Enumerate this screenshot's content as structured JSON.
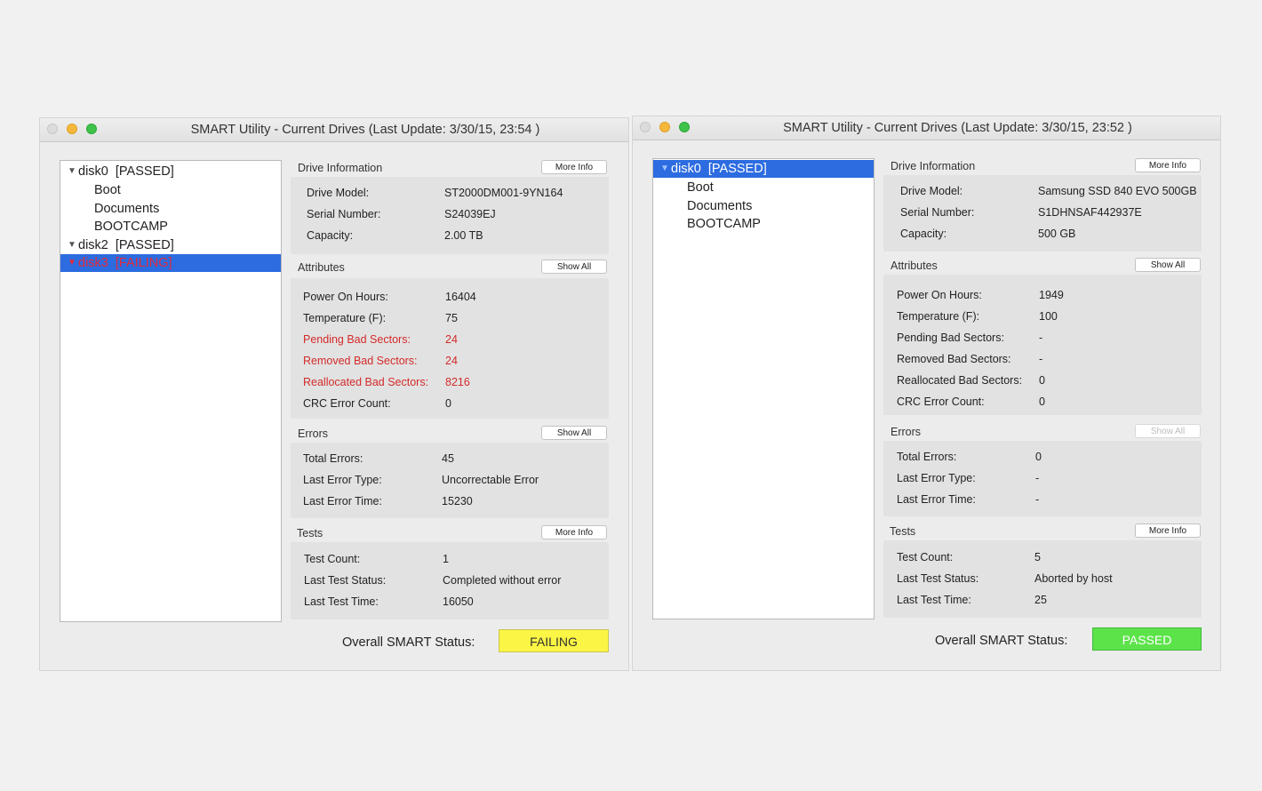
{
  "left": {
    "title": "SMART Utility - Current Drives (Last Update: 3/30/15, 23:54 )",
    "tree": [
      {
        "label": "disk0  [PASSED]"
      },
      {
        "label": "Boot"
      },
      {
        "label": "Documents"
      },
      {
        "label": "BOOTCAMP"
      },
      {
        "label": "disk2  [PASSED]"
      },
      {
        "label": "disk3  [FAILING]"
      }
    ],
    "drive_info": {
      "heading": "Drive Information",
      "button": "More Info",
      "model_label": "Drive Model:",
      "model": "ST2000DM001-9YN164",
      "serial_label": "Serial Number:",
      "serial": "S24039EJ",
      "capacity_label": "Capacity:",
      "capacity": "2.00 TB"
    },
    "attributes": {
      "heading": "Attributes",
      "button": "Show All",
      "rows": [
        {
          "label": "Power On Hours:",
          "value": "16404"
        },
        {
          "label": "Temperature (F):",
          "value": "75"
        },
        {
          "label": "Pending Bad Sectors:",
          "value": "24"
        },
        {
          "label": "Removed Bad Sectors:",
          "value": "24"
        },
        {
          "label": "Reallocated Bad Sectors:",
          "value": "8216"
        },
        {
          "label": "CRC Error Count:",
          "value": "0"
        }
      ]
    },
    "errors": {
      "heading": "Errors",
      "button": "Show All",
      "rows": [
        {
          "label": "Total Errors:",
          "value": "45"
        },
        {
          "label": "Last Error Type:",
          "value": "Uncorrectable Error"
        },
        {
          "label": "Last Error Time:",
          "value": "15230"
        }
      ]
    },
    "tests": {
      "heading": "Tests",
      "button": "More Info",
      "rows": [
        {
          "label": "Test Count:",
          "value": "1"
        },
        {
          "label": "Last Test Status:",
          "value": "Completed without error"
        },
        {
          "label": "Last Test Time:",
          "value": "16050"
        }
      ]
    },
    "overall": {
      "label": "Overall SMART Status:",
      "value": "FAILING"
    }
  },
  "right": {
    "title": "SMART Utility - Current Drives (Last Update: 3/30/15, 23:52 )",
    "tree": [
      {
        "label": "disk0  [PASSED]"
      },
      {
        "label": "Boot"
      },
      {
        "label": "Documents"
      },
      {
        "label": "BOOTCAMP"
      }
    ],
    "drive_info": {
      "heading": "Drive Information",
      "button": "More Info",
      "model_label": "Drive Model:",
      "model": "Samsung SSD 840 EVO 500GB",
      "serial_label": "Serial Number:",
      "serial": "S1DHNSAF442937E",
      "capacity_label": "Capacity:",
      "capacity": "500 GB"
    },
    "attributes": {
      "heading": "Attributes",
      "button": "Show All",
      "rows": [
        {
          "label": "Power On Hours:",
          "value": "1949"
        },
        {
          "label": "Temperature (F):",
          "value": "100"
        },
        {
          "label": "Pending Bad Sectors:",
          "value": "-"
        },
        {
          "label": "Removed Bad Sectors:",
          "value": "-"
        },
        {
          "label": "Reallocated Bad Sectors:",
          "value": "0"
        },
        {
          "label": "CRC Error Count:",
          "value": "0"
        }
      ]
    },
    "errors": {
      "heading": "Errors",
      "button": "Show All",
      "rows": [
        {
          "label": "Total Errors:",
          "value": "0"
        },
        {
          "label": "Last Error Type:",
          "value": "-"
        },
        {
          "label": "Last Error Time:",
          "value": "-"
        }
      ]
    },
    "tests": {
      "heading": "Tests",
      "button": "More Info",
      "rows": [
        {
          "label": "Test Count:",
          "value": "5"
        },
        {
          "label": "Last Test Status:",
          "value": "Aborted by host"
        },
        {
          "label": "Last Test Time:",
          "value": "25"
        }
      ]
    },
    "overall": {
      "label": "Overall SMART Status:",
      "value": "PASSED"
    }
  },
  "colors": {
    "selection": "#2c6ce0",
    "failing_text": "#d42a2a",
    "status_failing": "#fbf545",
    "status_passed": "#5de34a"
  }
}
